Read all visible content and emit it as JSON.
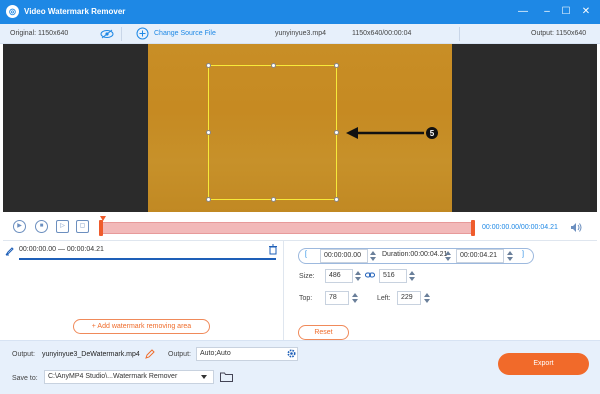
{
  "window": {
    "title": "Video Watermark Remover",
    "minimize_icon": "minimize-icon",
    "maximize_icon": "maximize-icon",
    "close_icon": "close-icon",
    "accent_color": "#1e88e5"
  },
  "infobar": {
    "original_label": "Original: 1150x640",
    "change_source_label": "Change Source File",
    "filename": "yunyinyue3.mp4",
    "resolution_duration": "1150x640/00:00:04",
    "output_label": "Output: 1150x640"
  },
  "playback": {
    "current_total_time": "00:00:00.00/00:00:04.21"
  },
  "segment": {
    "start": "00:00:00.00",
    "end": "00:00:04.21",
    "dash": "—"
  },
  "left_panel": {
    "add_area_label": "+  Add watermark removing area"
  },
  "right_panel": {
    "start_time": "00:00:00.00",
    "duration": "Duration:00:00:04.21",
    "end_time": "00:00:04.21",
    "size_label": "Size:",
    "width": "486",
    "height": "516",
    "top_label": "Top:",
    "top": "78",
    "left_label": "Left:",
    "left": "229",
    "reset_label": "Reset"
  },
  "bottom": {
    "output_label": "Output:",
    "output_filename": "yunyinyue3_DeWatermark.mp4",
    "output2_label": "Output:",
    "output_format": "Auto;Auto",
    "save_to_label": "Save to:",
    "save_path": "C:\\AnyMP4 Studio\\...Watermark Remover",
    "export_label": "Export",
    "export_color": "#f16a2a"
  }
}
